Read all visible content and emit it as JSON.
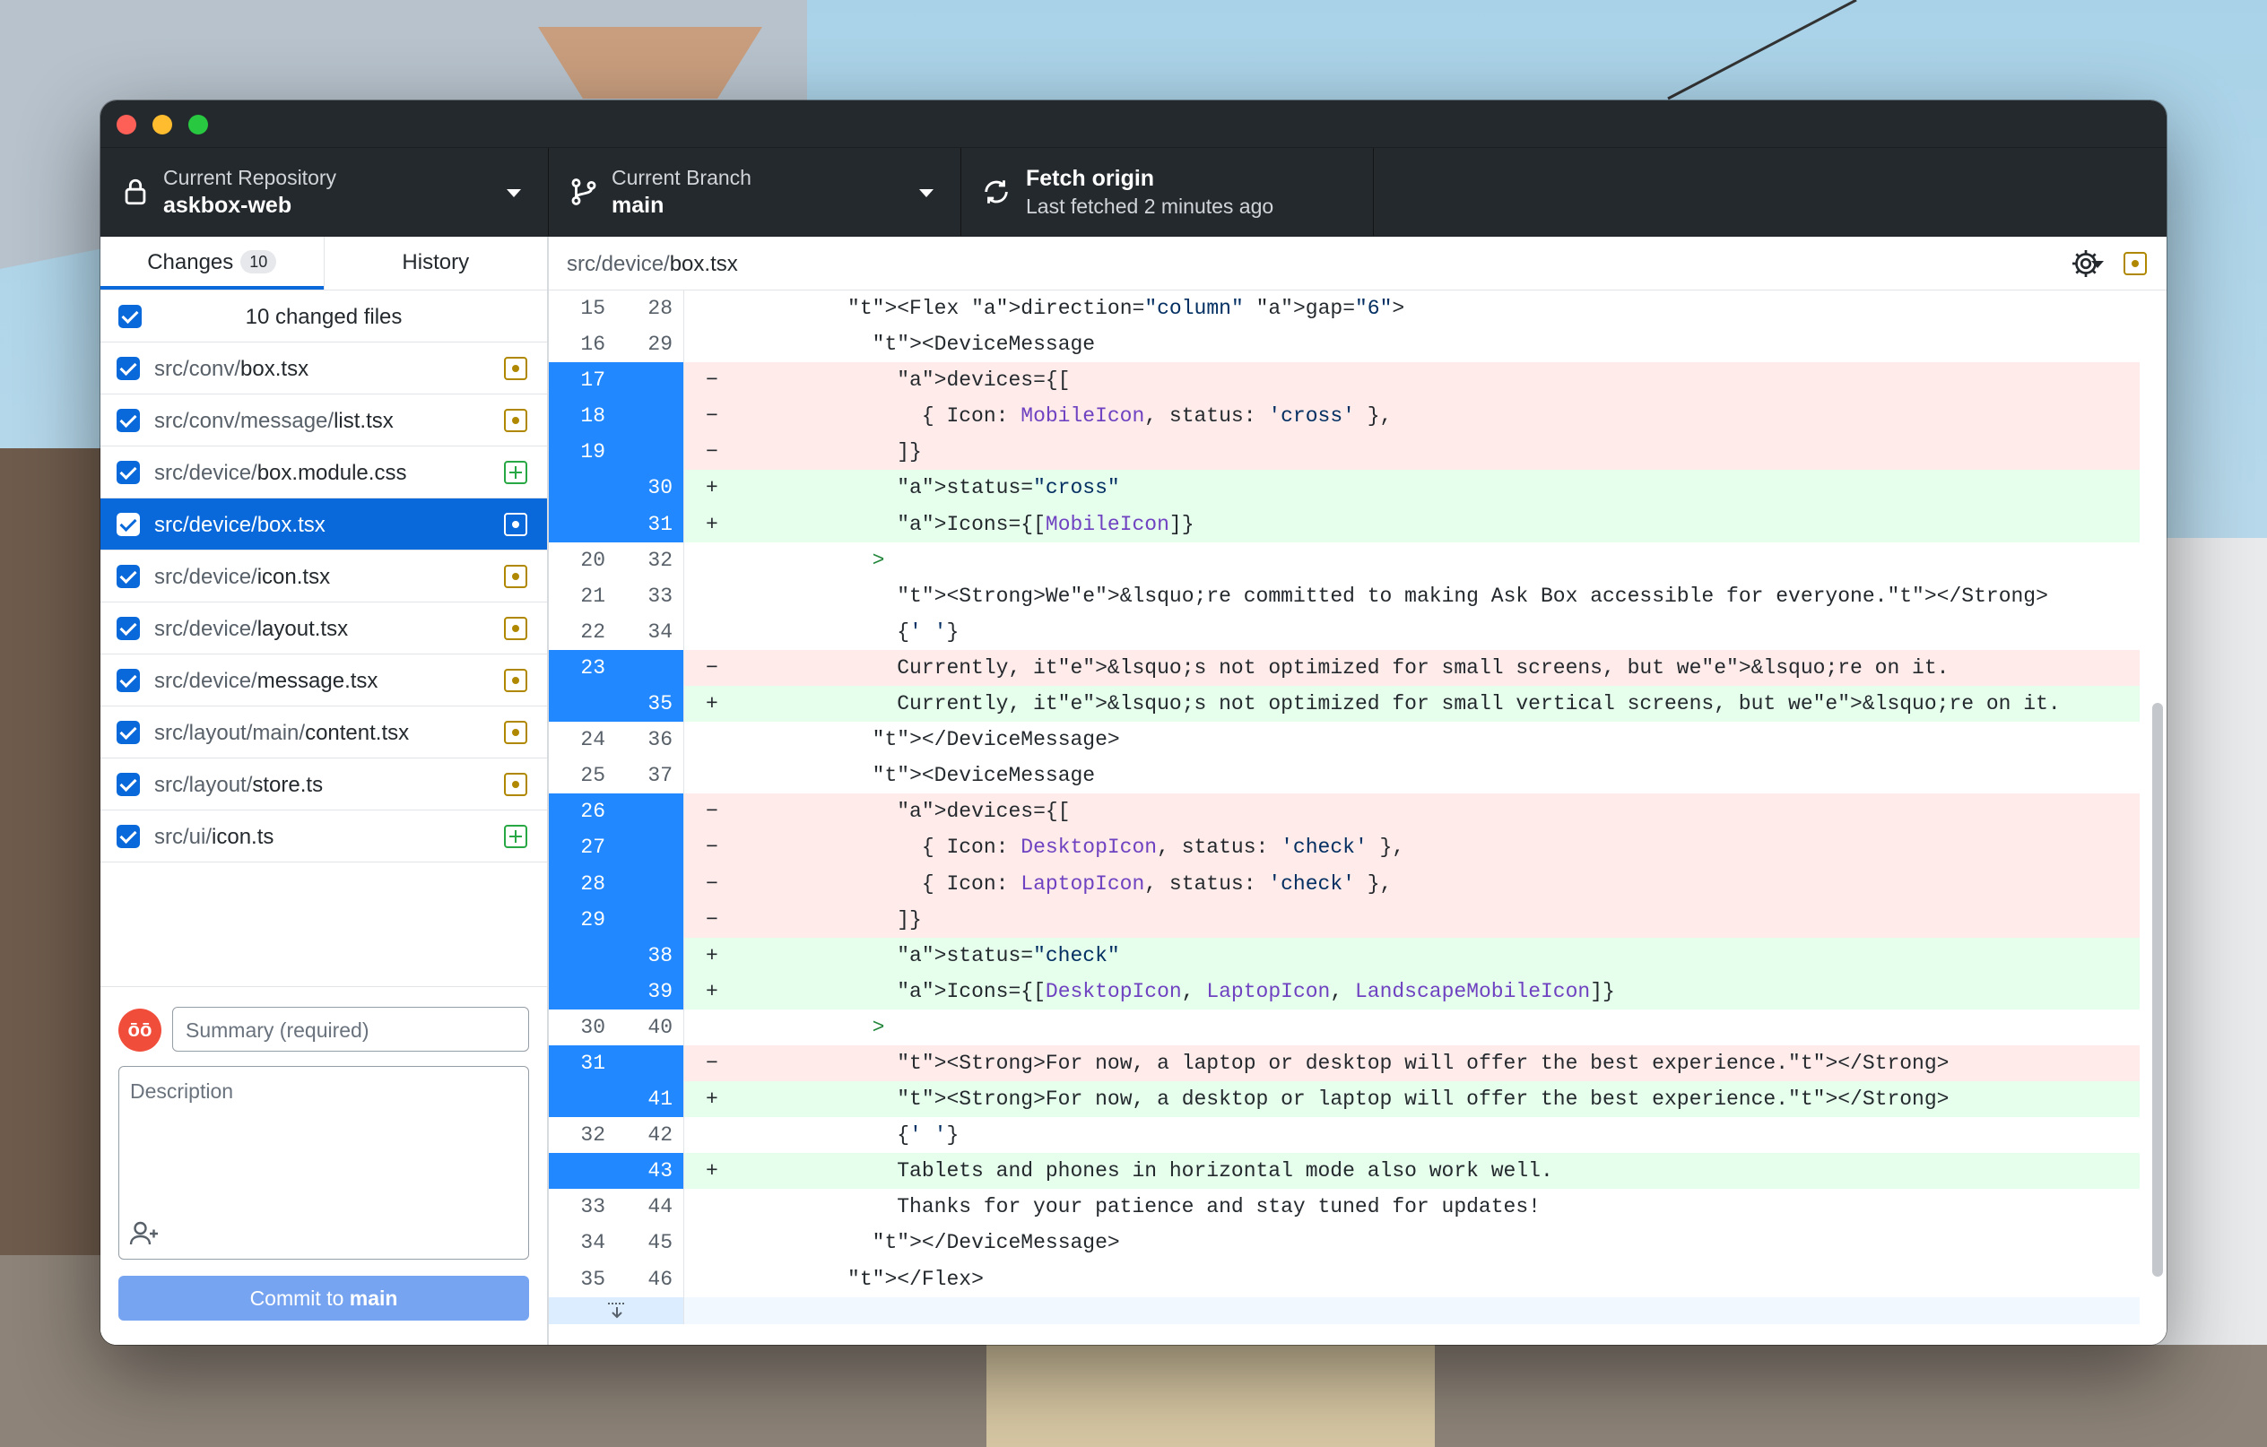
{
  "window": {
    "repo_label": "Current Repository",
    "repo_name": "askbox-web",
    "branch_label": "Current Branch",
    "branch_name": "main",
    "fetch_label": "Fetch origin",
    "fetch_status": "Last fetched 2 minutes ago"
  },
  "sidebar": {
    "tab_changes": "Changes",
    "changes_count": "10",
    "tab_history": "History",
    "changed_files_label": "10 changed files",
    "files": [
      {
        "dir": "src/conv/",
        "name": "box.tsx",
        "status": "modified",
        "status_icon": "modified-file-icon"
      },
      {
        "dir": "src/conv/message/",
        "name": "list.tsx",
        "status": "modified",
        "status_icon": "modified-file-icon"
      },
      {
        "dir": "src/device/",
        "name": "box.module.css",
        "status": "added",
        "status_icon": "added-file-icon"
      },
      {
        "dir": "src/device/",
        "name": "box.tsx",
        "status": "modified",
        "status_icon": "modified-file-icon",
        "selected": true
      },
      {
        "dir": "src/device/",
        "name": "icon.tsx",
        "status": "modified",
        "status_icon": "modified-file-icon"
      },
      {
        "dir": "src/device/",
        "name": "layout.tsx",
        "status": "modified",
        "status_icon": "modified-file-icon"
      },
      {
        "dir": "src/device/",
        "name": "message.tsx",
        "status": "modified",
        "status_icon": "modified-file-icon"
      },
      {
        "dir": "src/layout/main/",
        "name": "content.tsx",
        "status": "modified",
        "status_icon": "modified-file-icon"
      },
      {
        "dir": "src/layout/",
        "name": "store.ts",
        "status": "modified",
        "status_icon": "modified-file-icon"
      },
      {
        "dir": "src/ui/",
        "name": "icon.ts",
        "status": "added",
        "status_icon": "added-file-icon"
      }
    ]
  },
  "commit": {
    "summary_placeholder": "Summary (required)",
    "description_placeholder": "Description",
    "button_prefix": "Commit to ",
    "button_branch": "main"
  },
  "diff": {
    "path_dir": "src/device/",
    "path_file": "box.tsx",
    "lines": [
      {
        "type": "ctx",
        "old": "15",
        "new": "28",
        "code": "          <Flex direction=\"column\" gap=\"6\">"
      },
      {
        "type": "ctx",
        "old": "16",
        "new": "29",
        "code": "            <DeviceMessage"
      },
      {
        "type": "del",
        "old": "17",
        "new": "",
        "code": "              devices={["
      },
      {
        "type": "del",
        "old": "18",
        "new": "",
        "code": "                { Icon: MobileIcon, status: 'cross' },"
      },
      {
        "type": "del",
        "old": "19",
        "new": "",
        "code": "              ]}"
      },
      {
        "type": "add",
        "old": "",
        "new": "30",
        "code": "              status=\"cross\""
      },
      {
        "type": "add",
        "old": "",
        "new": "31",
        "code": "              Icons={[MobileIcon]}"
      },
      {
        "type": "ctx",
        "old": "20",
        "new": "32",
        "code": "            >"
      },
      {
        "type": "ctx",
        "old": "21",
        "new": "33",
        "code": "              <Strong>We&lsquo;re committed to making Ask Box accessible for everyone.</Strong>"
      },
      {
        "type": "ctx",
        "old": "22",
        "new": "34",
        "code": "              {' '}"
      },
      {
        "type": "del",
        "old": "23",
        "new": "",
        "code": "              Currently, it&lsquo;s not optimized for small screens, but we&lsquo;re on it."
      },
      {
        "type": "add",
        "old": "",
        "new": "35",
        "code": "              Currently, it&lsquo;s not optimized for small vertical screens, but we&lsquo;re on it."
      },
      {
        "type": "ctx",
        "old": "24",
        "new": "36",
        "code": "            </DeviceMessage>"
      },
      {
        "type": "ctx",
        "old": "25",
        "new": "37",
        "code": "            <DeviceMessage"
      },
      {
        "type": "del",
        "old": "26",
        "new": "",
        "code": "              devices={["
      },
      {
        "type": "del",
        "old": "27",
        "new": "",
        "code": "                { Icon: DesktopIcon, status: 'check' },"
      },
      {
        "type": "del",
        "old": "28",
        "new": "",
        "code": "                { Icon: LaptopIcon, status: 'check' },"
      },
      {
        "type": "del",
        "old": "29",
        "new": "",
        "code": "              ]}"
      },
      {
        "type": "add",
        "old": "",
        "new": "38",
        "code": "              status=\"check\""
      },
      {
        "type": "add",
        "old": "",
        "new": "39",
        "code": "              Icons={[DesktopIcon, LaptopIcon, LandscapeMobileIcon]}"
      },
      {
        "type": "ctx",
        "old": "30",
        "new": "40",
        "code": "            >"
      },
      {
        "type": "del",
        "old": "31",
        "new": "",
        "code": "              <Strong>For now, a laptop or desktop will offer the best experience.</Strong>"
      },
      {
        "type": "add",
        "old": "",
        "new": "41",
        "code": "              <Strong>For now, a desktop or laptop will offer the best experience.</Strong>"
      },
      {
        "type": "ctx",
        "old": "32",
        "new": "42",
        "code": "              {' '}"
      },
      {
        "type": "add",
        "old": "",
        "new": "43",
        "code": "              Tablets and phones in horizontal mode also work well."
      },
      {
        "type": "ctx",
        "old": "33",
        "new": "44",
        "code": "              Thanks for your patience and stay tuned for updates!"
      },
      {
        "type": "ctx",
        "old": "34",
        "new": "45",
        "code": "            </DeviceMessage>"
      },
      {
        "type": "ctx",
        "old": "35",
        "new": "46",
        "code": "          </Flex>"
      }
    ]
  },
  "colors": {
    "accent": "#0969da",
    "gutter_changed": "#2188ff",
    "deleted_bg": "#ffebe9",
    "added_bg": "#e6ffec",
    "toolbar": "#24292e"
  }
}
